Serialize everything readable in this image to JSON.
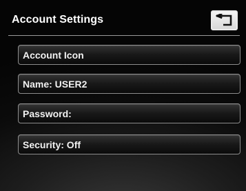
{
  "header": {
    "title": "Account Settings",
    "back_icon": "back-return-icon"
  },
  "menu": {
    "items": [
      {
        "label": "Account Icon"
      },
      {
        "label": "Name: USER2"
      },
      {
        "label": "Password:"
      },
      {
        "label": "Security: Off"
      }
    ]
  },
  "colors": {
    "background_dark": "#0b0b0b",
    "button_border": "#8e8e8e",
    "text": "#ffffff",
    "back_button_bg": "#e6e6e6"
  }
}
